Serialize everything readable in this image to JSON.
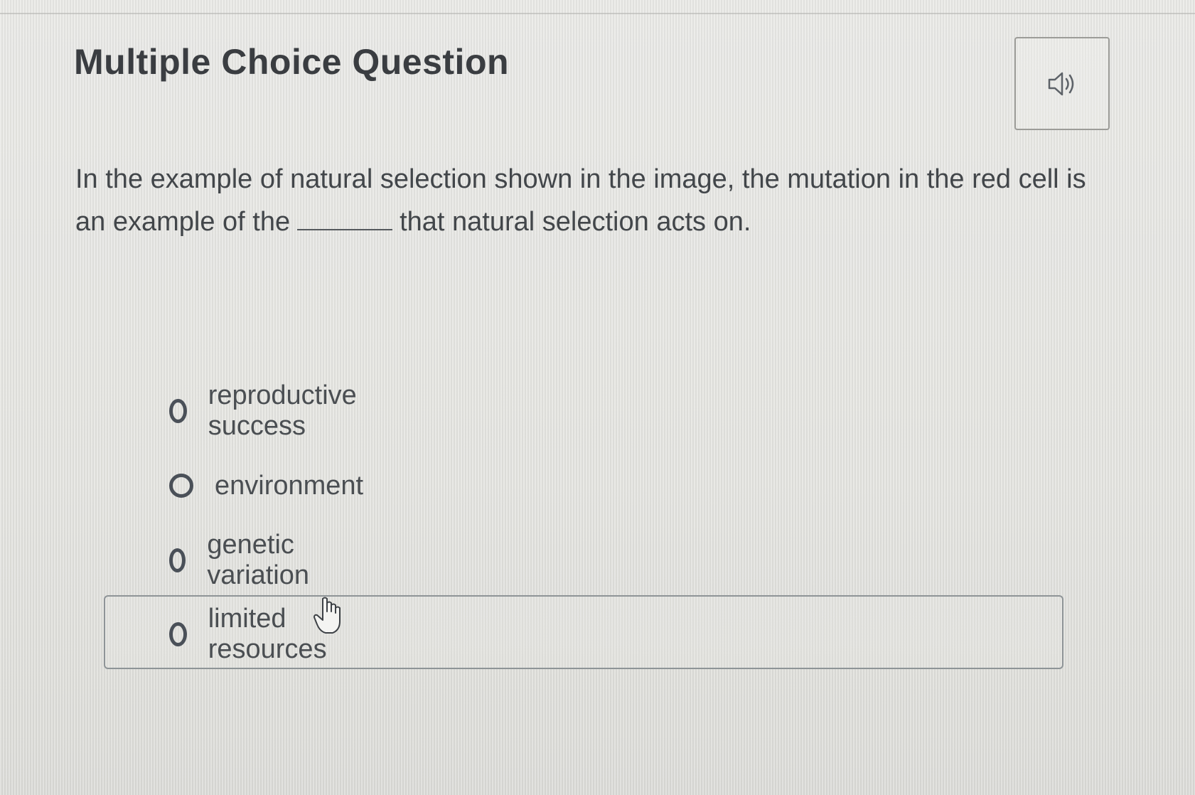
{
  "header": {
    "title": "Multiple Choice Question",
    "audio_icon": "speaker-icon"
  },
  "question": {
    "text_before": "In the example of natural selection shown in the image, the mutation in the red cell is an example of the",
    "text_after": "that natural selection acts on."
  },
  "options": [
    {
      "label": "reproductive success"
    },
    {
      "label": "environment"
    },
    {
      "label": "genetic variation"
    },
    {
      "label": "limited resources"
    }
  ],
  "focused_option_index": 3,
  "cursor_icon": "hand-pointer-icon"
}
